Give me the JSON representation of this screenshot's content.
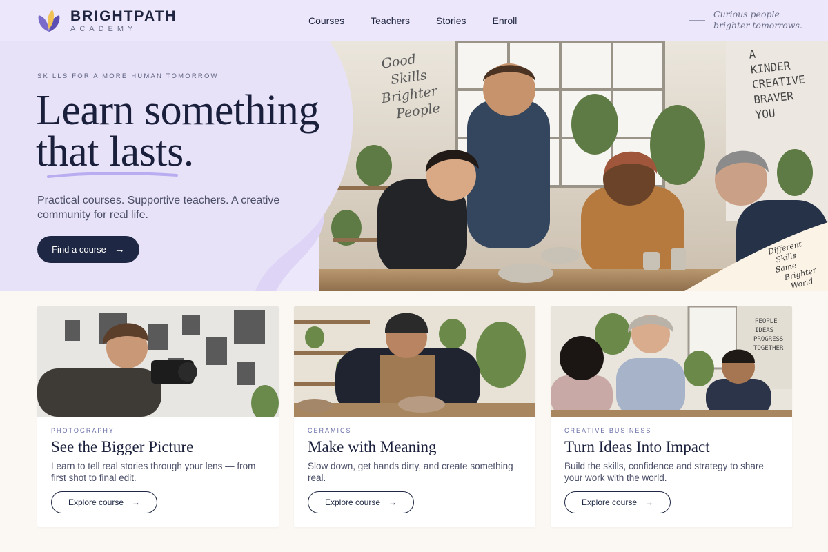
{
  "brand": {
    "name": "BRIGHTPATH",
    "sub": "ACADEMY"
  },
  "nav": [
    "Courses",
    "Teachers",
    "Stories",
    "Enroll"
  ],
  "tagline": [
    "Curious people",
    "brighter tomorrows."
  ],
  "hero": {
    "eyebrow": "SKILLS FOR A MORE HUMAN TOMORROW",
    "title_line1": "Learn something",
    "title_line2": "that lasts.",
    "subtitle": "Practical courses. Supportive teachers. A creative community for real life.",
    "cta": "Find a course",
    "cta_arrow": "→",
    "wall_text_left": [
      "Good",
      "Skills",
      "Brighter",
      "People"
    ],
    "wall_text_right": [
      "A",
      "KINDER",
      "CREATIVE",
      "BRAVER",
      "YOU"
    ],
    "corner_note": [
      "Different",
      "Skills",
      "Same",
      "Brighter",
      "World"
    ]
  },
  "cards": [
    {
      "category": "PHOTOGRAPHY",
      "title": "See the Bigger Picture",
      "description": "Learn to tell real stories through your lens — from first shot to final edit.",
      "button": "Explore course",
      "arrow": "→"
    },
    {
      "category": "CERAMICS",
      "title": "Make with Meaning",
      "description": "Slow down, get hands dirty, and create something real.",
      "button": "Explore course",
      "arrow": "→"
    },
    {
      "category": "CREATIVE BUSINESS",
      "title": "Turn Ideas Into Impact",
      "description": "Build the skills, confidence and strategy to share your work with the world.",
      "button": "Explore course",
      "arrow": "→",
      "wall_sign": [
        "PEOPLE",
        "IDEAS",
        "PROGRESS",
        "TOGETHER"
      ]
    }
  ],
  "colors": {
    "lavender": "#ece7fa",
    "navy": "#1e2844",
    "cream": "#fbf8f3",
    "accent": "#b9acf0"
  }
}
